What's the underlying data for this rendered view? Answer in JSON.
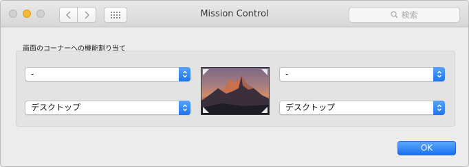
{
  "window": {
    "title": "Mission Control"
  },
  "toolbar": {
    "back_icon": "chevron-left-icon",
    "forward_icon": "chevron-right-icon",
    "show_all_icon": "grid-icon",
    "search": {
      "placeholder": "検索",
      "icon": "search-icon"
    }
  },
  "hot_corners": {
    "group_label": "画面のコーナーへの機能割り当て",
    "top_left": "-",
    "bottom_left": "デスクトップ",
    "top_right": "-",
    "bottom_right": "デスクトップ"
  },
  "dialog": {
    "ok_label": "OK"
  },
  "colors": {
    "accent": "#1f74f0",
    "minimize": "#f5b935"
  }
}
